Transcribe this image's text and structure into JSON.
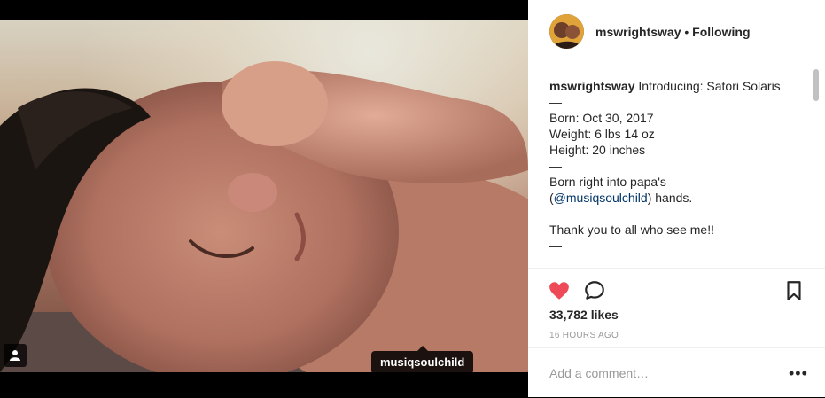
{
  "header": {
    "username": "mswrightsway",
    "separator": " • ",
    "follow_label": "Following"
  },
  "caption": {
    "username": "mswrightsway",
    "lines": [
      " Introducing: Satori Solaris",
      "—",
      "Born: Oct 30, 2017",
      "Weight: 6 lbs 14 oz",
      "Height: 20 inches",
      "—",
      "Born right into papa's",
      "—",
      "Thank you to all who see me!!",
      "—"
    ],
    "mention_prefix": "(",
    "mention": "@musiqsoulchild",
    "mention_suffix": ") hands."
  },
  "media": {
    "tag_label": "musiqsoulchild"
  },
  "stats": {
    "likes": "33,782 likes",
    "time": "16 HOURS AGO"
  },
  "comment": {
    "placeholder": "Add a comment…",
    "more_label": "•••"
  },
  "colors": {
    "like_red": "#ed4956",
    "link_blue": "#003569",
    "text": "#262626",
    "muted": "#999999"
  },
  "icons": [
    "user-tag-icon",
    "heart-icon",
    "comment-icon",
    "bookmark-icon",
    "more-icon"
  ]
}
